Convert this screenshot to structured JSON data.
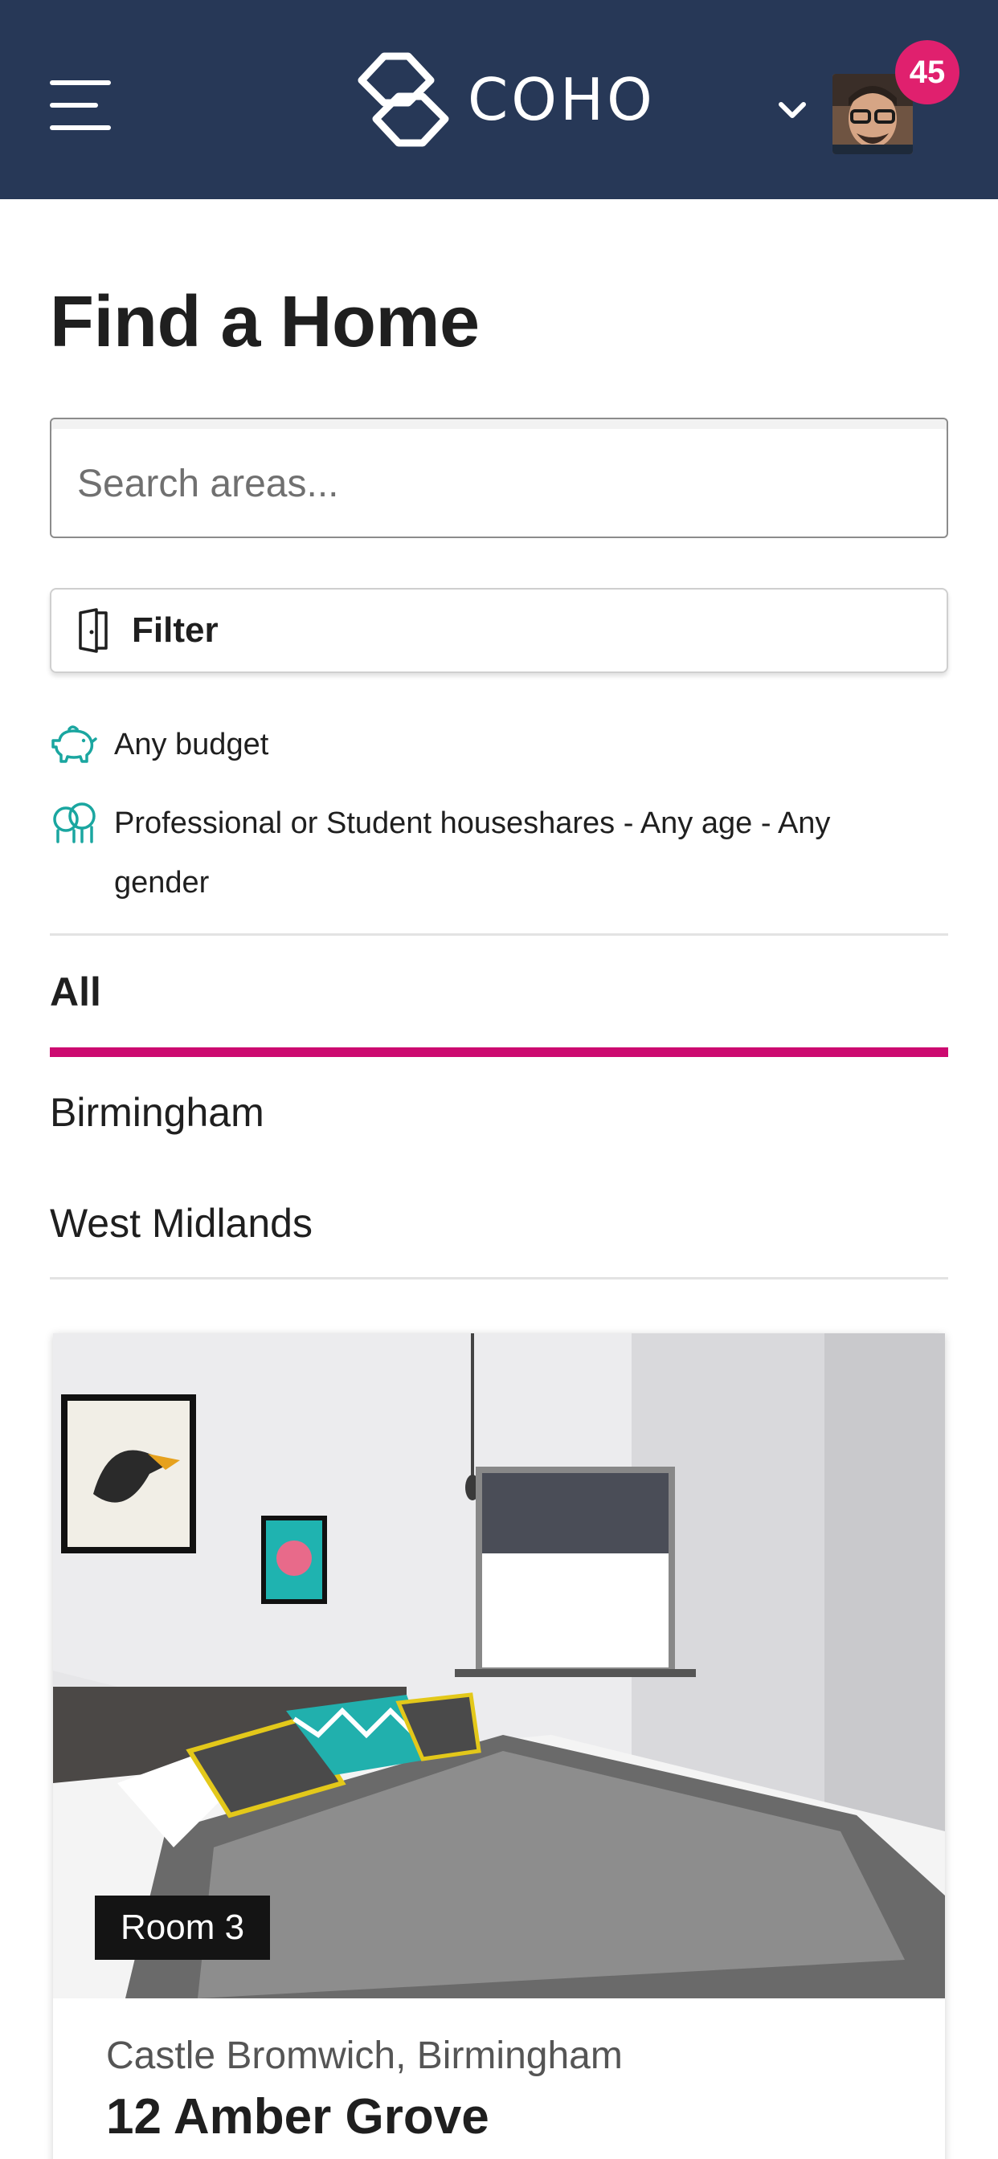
{
  "header": {
    "brand": "COHO",
    "notification_count": "45",
    "colors": {
      "bar": "#273857",
      "badge": "#e0206e"
    },
    "icons": [
      "menu-icon",
      "coho-logo-icon",
      "chevron-down-icon",
      "avatar"
    ]
  },
  "page": {
    "title": "Find a Home"
  },
  "search": {
    "placeholder": "Search areas..."
  },
  "filter": {
    "label": "Filter",
    "icon": "door-icon"
  },
  "criteria": {
    "budget": "Any budget",
    "budget_icon": "piggy-bank-icon",
    "household": "Professional or Student houseshares - Any age - Any gender",
    "household_icon": "people-icon",
    "accent": "#1aa6a0"
  },
  "tabs": {
    "active": "All",
    "items": [
      "Birmingham",
      "West Midlands"
    ],
    "active_color": "#cc0a70"
  },
  "listing": {
    "room_tag": "Room 3",
    "location": "Castle Bromwich, Birmingham",
    "title": "12 Amber Grove"
  }
}
